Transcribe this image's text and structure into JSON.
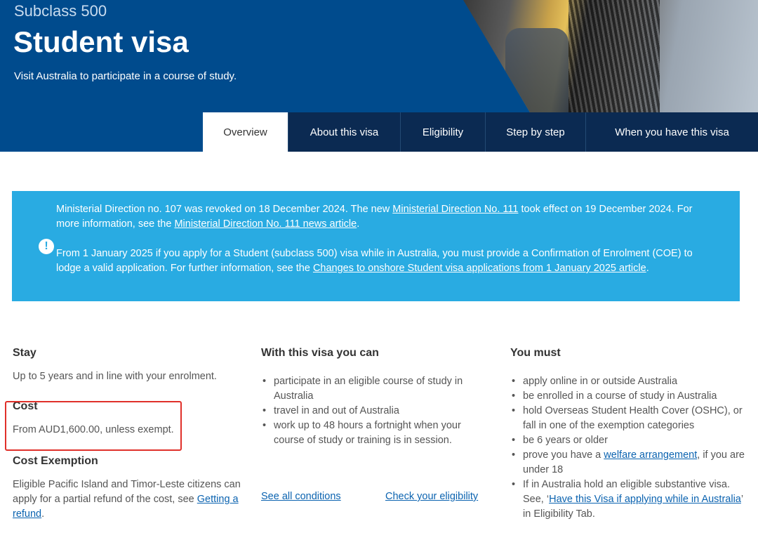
{
  "hero": {
    "subclass": "Subclass 500",
    "title": "Student visa",
    "subtitle": "Visit Australia to participate in a course of study."
  },
  "tabs": [
    {
      "label": "Overview",
      "active": true
    },
    {
      "label": "About this visa",
      "active": false
    },
    {
      "label": "Eligibility",
      "active": false
    },
    {
      "label": "Step by step",
      "active": false
    },
    {
      "label": "When you have this visa",
      "active": false
    }
  ],
  "notice": {
    "icon": "info-icon",
    "p1_text_a": "Ministerial Direction no. 107 was revoked on 18 December 2024. The new ",
    "p1_link_a": "Ministerial Direction No. 111",
    "p1_text_b": " took effect on 19 December 2024. For more information, see the ",
    "p1_link_b": "Ministerial Direction No. 111 news article",
    "p1_text_c": ".",
    "p2_text_a": "From 1 January 2025 if you apply for a Student (subclass 500) visa while in Australia, you must provide a Confirmation of Enrolment (COE) to lodge a valid application. For further information, see the ",
    "p2_link": "Changes to onshore Student visa applications from 1 January 2025 article",
    "p2_text_b": "."
  },
  "stay": {
    "heading": "Stay",
    "text": "Up to 5 years and in line with your enrolment."
  },
  "cost": {
    "heading": "Cost",
    "text": "From AUD1,600.00, unless exempt."
  },
  "cost_exemption": {
    "heading": "Cost Exemption",
    "text": "Eligible Pacific Island and Timor-Leste citizens can apply for a partial refund of the cost, see ",
    "link": "Getting a refund",
    "end": "."
  },
  "with_visa": {
    "heading": "With this visa you can",
    "items": [
      "participate in an eligible course of study in Australia",
      "travel in and out of Australia",
      "work up to 48 hours a fortnight when your course of study or training is in session."
    ],
    "see_conditions": "See all conditions",
    "check_eligibility": "Check your eligibility"
  },
  "you_must": {
    "heading": "You must",
    "item1": "apply online in or outside Australia",
    "item2": "be enrolled in a course of study in Australia",
    "item3": "hold Overseas Student Health Cover (OSHC), or fall in one of the exemption categories",
    "item4": "be 6 years or older",
    "item5_a": "prove you have a ",
    "item5_link": "welfare arrangement",
    "item5_b": ", if you are under 18",
    "item6_a": "If in Australia hold an eligible substantive visa. See, ‘",
    "item6_link": "Have this Visa if applying while in Australia",
    "item6_b": "’ in Eligibility Tab."
  },
  "colors": {
    "hero_blue": "#004b8d",
    "tab_navy": "#0b2a52",
    "notice_blue": "#29abe2",
    "link_blue": "#0b63b0",
    "highlight_red": "#e0302a"
  }
}
